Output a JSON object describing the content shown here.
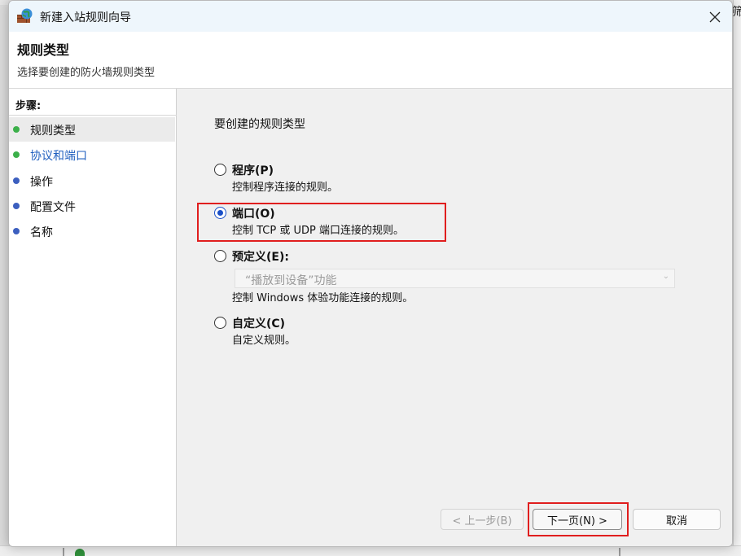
{
  "window": {
    "title": "新建入站规则向导",
    "close_glyph": "✕"
  },
  "header": {
    "title": "规则类型",
    "subtitle": "选择要创建的防火墙规则类型"
  },
  "steps": {
    "heading": "步骤:",
    "items": [
      {
        "label": "规则类型",
        "dot_color": "#3cb04a",
        "label_color": "#111111"
      },
      {
        "label": "协议和端口",
        "dot_color": "#3cb04a",
        "label_color": "#1f5fbf"
      },
      {
        "label": "操作",
        "dot_color": "#3c5fbf",
        "label_color": "#111111"
      },
      {
        "label": "配置文件",
        "dot_color": "#3c5fbf",
        "label_color": "#111111"
      },
      {
        "label": "名称",
        "dot_color": "#3c5fbf",
        "label_color": "#111111"
      }
    ]
  },
  "content": {
    "prompt": "要创建的规则类型",
    "options": [
      {
        "title": "程序(P)",
        "desc": "控制程序连接的规则。",
        "checked": false
      },
      {
        "title": "端口(O)",
        "desc": "控制 TCP 或 UDP 端口连接的规则。",
        "checked": true
      },
      {
        "title": "预定义(E):",
        "desc": "控制 Windows 体验功能连接的规则。",
        "checked": false
      },
      {
        "title": "自定义(C)",
        "desc": "自定义规则。",
        "checked": false
      }
    ],
    "predefined_select": {
      "value": "“播放到设备”功能",
      "caret": "⌄"
    }
  },
  "buttons": {
    "back": "< 上一步(B)",
    "next": "下一页(N) >",
    "cancel": "取消"
  },
  "background": {
    "right_edge_glyph": "筛"
  },
  "colors": {
    "highlight": "#e01e1e",
    "radio_accent": "#1a4fc7"
  }
}
